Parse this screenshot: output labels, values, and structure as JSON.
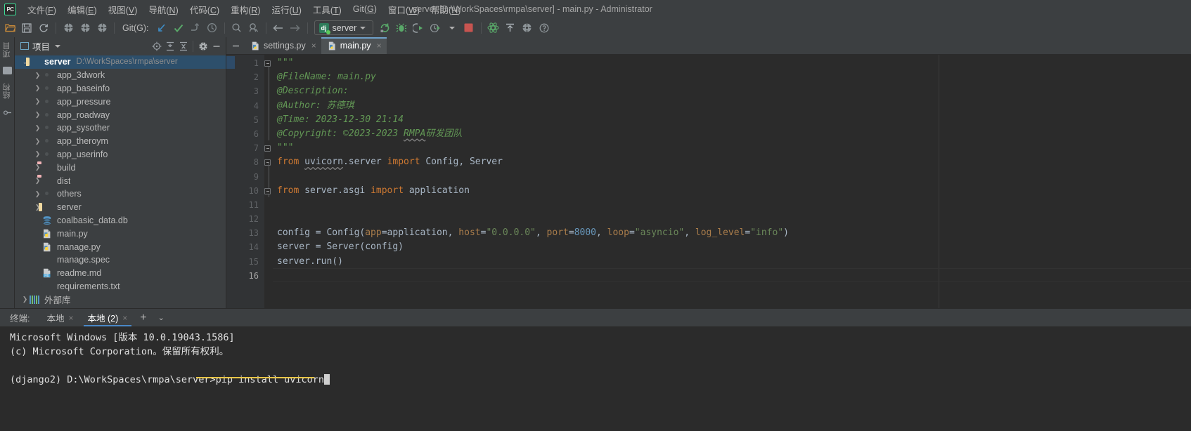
{
  "window": {
    "title": "server [D:\\WorkSpaces\\rmpa\\server] - main.py - Administrator",
    "logo": "PC"
  },
  "menubar": {
    "items": [
      {
        "label": "文件(F)",
        "name": "menu-file"
      },
      {
        "label": "编辑(E)",
        "name": "menu-edit"
      },
      {
        "label": "视图(V)",
        "name": "menu-view"
      },
      {
        "label": "导航(N)",
        "name": "menu-navigate"
      },
      {
        "label": "代码(C)",
        "name": "menu-code"
      },
      {
        "label": "重构(R)",
        "name": "menu-refactor"
      },
      {
        "label": "运行(U)",
        "name": "menu-run"
      },
      {
        "label": "工具(T)",
        "name": "menu-tools"
      },
      {
        "label": "Git(G)",
        "name": "menu-git"
      },
      {
        "label": "窗口(W)",
        "name": "menu-window"
      },
      {
        "label": "帮助(H)",
        "name": "menu-help"
      }
    ]
  },
  "toolbar": {
    "git_label": "Git(G):",
    "run_config": "server",
    "icons": [
      "open-folder-icon",
      "save-all-icon",
      "sync-icon",
      "vcs-update-icon",
      "vcs-commit-icon",
      "vcs-push-icon",
      "git-update-icon",
      "git-commit-icon",
      "git-push-icon",
      "git-history-icon",
      "search-icon",
      "search-everywhere-icon",
      "back-icon",
      "forward-icon",
      "rerun-icon",
      "debug-icon",
      "run-coverage-icon",
      "profile-icon",
      "stop-icon",
      "python-console-icon",
      "upload-icon",
      "settings-icon",
      "help-icon"
    ]
  },
  "left_strip": {
    "tabs": [
      "项目",
      "结构",
      "收藏夹"
    ]
  },
  "project": {
    "header_title": "项目",
    "header_icons": [
      "locate-icon",
      "expand-all-icon",
      "collapse-all-icon",
      "gear-icon",
      "hide-icon"
    ],
    "tree": [
      {
        "label": "server",
        "path": "D:\\WorkSpaces\\rmpa\\server",
        "icon": "orange-folder-icon",
        "depth": 0,
        "arrow": "down",
        "selected": true
      },
      {
        "label": "app_3dwork",
        "icon": "module-folder-icon",
        "depth": 1,
        "arrow": "right"
      },
      {
        "label": "app_baseinfo",
        "icon": "module-folder-icon",
        "depth": 1,
        "arrow": "right"
      },
      {
        "label": "app_pressure",
        "icon": "module-folder-icon",
        "depth": 1,
        "arrow": "right"
      },
      {
        "label": "app_roadway",
        "icon": "module-folder-icon",
        "depth": 1,
        "arrow": "right"
      },
      {
        "label": "app_sysother",
        "icon": "module-folder-icon",
        "depth": 1,
        "arrow": "right"
      },
      {
        "label": "app_theroym",
        "icon": "module-folder-icon",
        "depth": 1,
        "arrow": "right"
      },
      {
        "label": "app_userinfo",
        "icon": "module-folder-icon",
        "depth": 1,
        "arrow": "right"
      },
      {
        "label": "build",
        "icon": "excluded-folder-icon",
        "depth": 1,
        "arrow": "right"
      },
      {
        "label": "dist",
        "icon": "excluded-folder-icon",
        "depth": 1,
        "arrow": "right"
      },
      {
        "label": "others",
        "icon": "module-folder-icon",
        "depth": 1,
        "arrow": "right"
      },
      {
        "label": "server",
        "icon": "orange-folder-icon",
        "depth": 1,
        "arrow": "right"
      },
      {
        "label": "coalbasic_data.db",
        "icon": "database-icon",
        "depth": 1,
        "arrow": "none"
      },
      {
        "label": "main.py",
        "icon": "python-file-icon",
        "depth": 1,
        "arrow": "none"
      },
      {
        "label": "manage.py",
        "icon": "python-file-icon",
        "depth": 1,
        "arrow": "none"
      },
      {
        "label": "manage.spec",
        "icon": "text-file-icon",
        "depth": 1,
        "arrow": "none"
      },
      {
        "label": "readme.md",
        "icon": "markdown-file-icon",
        "depth": 1,
        "arrow": "none"
      },
      {
        "label": "requirements.txt",
        "icon": "text-file-icon",
        "depth": 1,
        "arrow": "none"
      },
      {
        "label": "外部库",
        "icon": "library-icon",
        "depth": 0,
        "arrow": "right"
      }
    ]
  },
  "editor": {
    "tabs": [
      {
        "label": "settings.py",
        "icon": "python-file-icon",
        "active": false,
        "close": "×"
      },
      {
        "label": "main.py",
        "icon": "python-file-icon",
        "active": true,
        "close": "×"
      }
    ],
    "line_numbers": [
      "1",
      "2",
      "3",
      "4",
      "5",
      "6",
      "7",
      "8",
      "9",
      "10",
      "11",
      "12",
      "13",
      "14",
      "15",
      "16"
    ],
    "current_line": 16,
    "lines": [
      {
        "n": 1,
        "tokens": [
          {
            "t": "\"\"\"",
            "c": "doc"
          }
        ]
      },
      {
        "n": 2,
        "tokens": [
          {
            "t": "@FileName: main.py",
            "c": "doc"
          }
        ]
      },
      {
        "n": 3,
        "tokens": [
          {
            "t": "@Description:",
            "c": "doc"
          }
        ]
      },
      {
        "n": 4,
        "tokens": [
          {
            "t": "@Author: 苏德琪",
            "c": "doc"
          }
        ]
      },
      {
        "n": 5,
        "tokens": [
          {
            "t": "@Time: 2023-12-30 21:14",
            "c": "doc"
          }
        ]
      },
      {
        "n": 6,
        "tokens": [
          {
            "t": "@Copyright: ©2023-2023 ",
            "c": "doc"
          },
          {
            "t": "RMPA",
            "c": "doc wavy"
          },
          {
            "t": "研发团队",
            "c": "doc"
          }
        ]
      },
      {
        "n": 7,
        "tokens": [
          {
            "t": "\"\"\"",
            "c": "doc"
          }
        ]
      },
      {
        "n": 8,
        "tokens": [
          {
            "t": "from ",
            "c": "kw"
          },
          {
            "t": "uvicorn",
            "c": "id wavy"
          },
          {
            "t": ".server ",
            "c": "id"
          },
          {
            "t": "import ",
            "c": "kw"
          },
          {
            "t": "Config, Server",
            "c": "id"
          }
        ]
      },
      {
        "n": 9,
        "tokens": []
      },
      {
        "n": 10,
        "tokens": [
          {
            "t": "from ",
            "c": "kw"
          },
          {
            "t": "server.asgi ",
            "c": "id"
          },
          {
            "t": "import ",
            "c": "kw"
          },
          {
            "t": "application",
            "c": "id"
          }
        ]
      },
      {
        "n": 11,
        "tokens": []
      },
      {
        "n": 12,
        "tokens": []
      },
      {
        "n": 13,
        "tokens": [
          {
            "t": "config = Config(",
            "c": "id"
          },
          {
            "t": "app",
            "c": "param"
          },
          {
            "t": "=application, ",
            "c": "id"
          },
          {
            "t": "host",
            "c": "param"
          },
          {
            "t": "=",
            "c": "id"
          },
          {
            "t": "\"0.0.0.0\"",
            "c": "str"
          },
          {
            "t": ", ",
            "c": "id"
          },
          {
            "t": "port",
            "c": "param"
          },
          {
            "t": "=",
            "c": "id"
          },
          {
            "t": "8000",
            "c": "num"
          },
          {
            "t": ", ",
            "c": "id"
          },
          {
            "t": "loop",
            "c": "param"
          },
          {
            "t": "=",
            "c": "id"
          },
          {
            "t": "\"asyncio\"",
            "c": "str"
          },
          {
            "t": ", ",
            "c": "id"
          },
          {
            "t": "log_level",
            "c": "param"
          },
          {
            "t": "=",
            "c": "id"
          },
          {
            "t": "\"info\"",
            "c": "str"
          },
          {
            "t": ")",
            "c": "id"
          }
        ]
      },
      {
        "n": 14,
        "tokens": [
          {
            "t": "server = Server(config)",
            "c": "id"
          }
        ]
      },
      {
        "n": 15,
        "tokens": [
          {
            "t": "server.run()",
            "c": "id"
          }
        ]
      },
      {
        "n": 16,
        "tokens": []
      }
    ]
  },
  "terminal": {
    "label": "终端:",
    "tabs": [
      {
        "label": "本地",
        "active": false,
        "close": "×"
      },
      {
        "label": "本地 (2)",
        "active": true,
        "close": "×"
      }
    ],
    "add_label": "+",
    "chevron": "⌄",
    "output": [
      "Microsoft Windows [版本 10.0.19043.1586]",
      "(c) Microsoft Corporation。保留所有权利。",
      ""
    ],
    "prompt": "(django2) D:\\WorkSpaces\\rmpa\\server>",
    "command": "pip install uvicorn",
    "underline_color": "#e8c547"
  },
  "colors": {
    "background": "#3c3f41",
    "editor_background": "#2b2b2b",
    "selection": "#2d4f6b",
    "accent": "#4a88c7",
    "string": "#6a8759",
    "keyword": "#cc7832",
    "doc": "#629755",
    "number": "#6897bb"
  }
}
